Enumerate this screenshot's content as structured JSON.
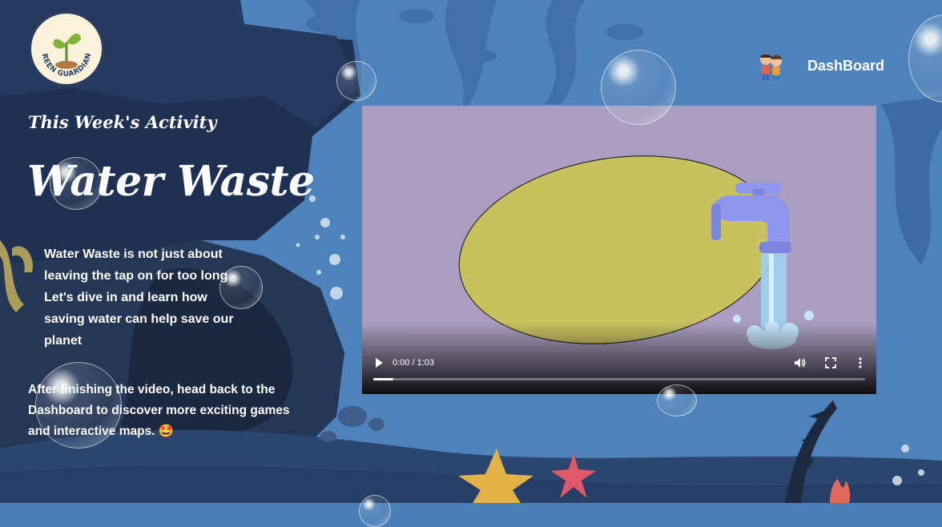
{
  "header": {
    "logo_text": "GREEN GUARDIANS",
    "nav_link": "DashBoard"
  },
  "activity": {
    "subtitle": "This Week's Activity",
    "title": "Water Waste",
    "description": "Water Waste is not just about leaving the tap on for too long - Let's dive in and learn how saving water can help save our planet",
    "after_text": "After finishing the video, head back to the Dashboard to discover more exciting games and interactive maps.",
    "emoji": "🤩"
  },
  "video": {
    "time": "0:00 / 1:03",
    "progress": 0.04
  },
  "colors": {
    "background": "#4a7fb8",
    "rock_dark": "#1e2f4f",
    "video_bg": "#aa9fc0",
    "oval": "#c9c05f",
    "tap": "#8f96ee"
  }
}
